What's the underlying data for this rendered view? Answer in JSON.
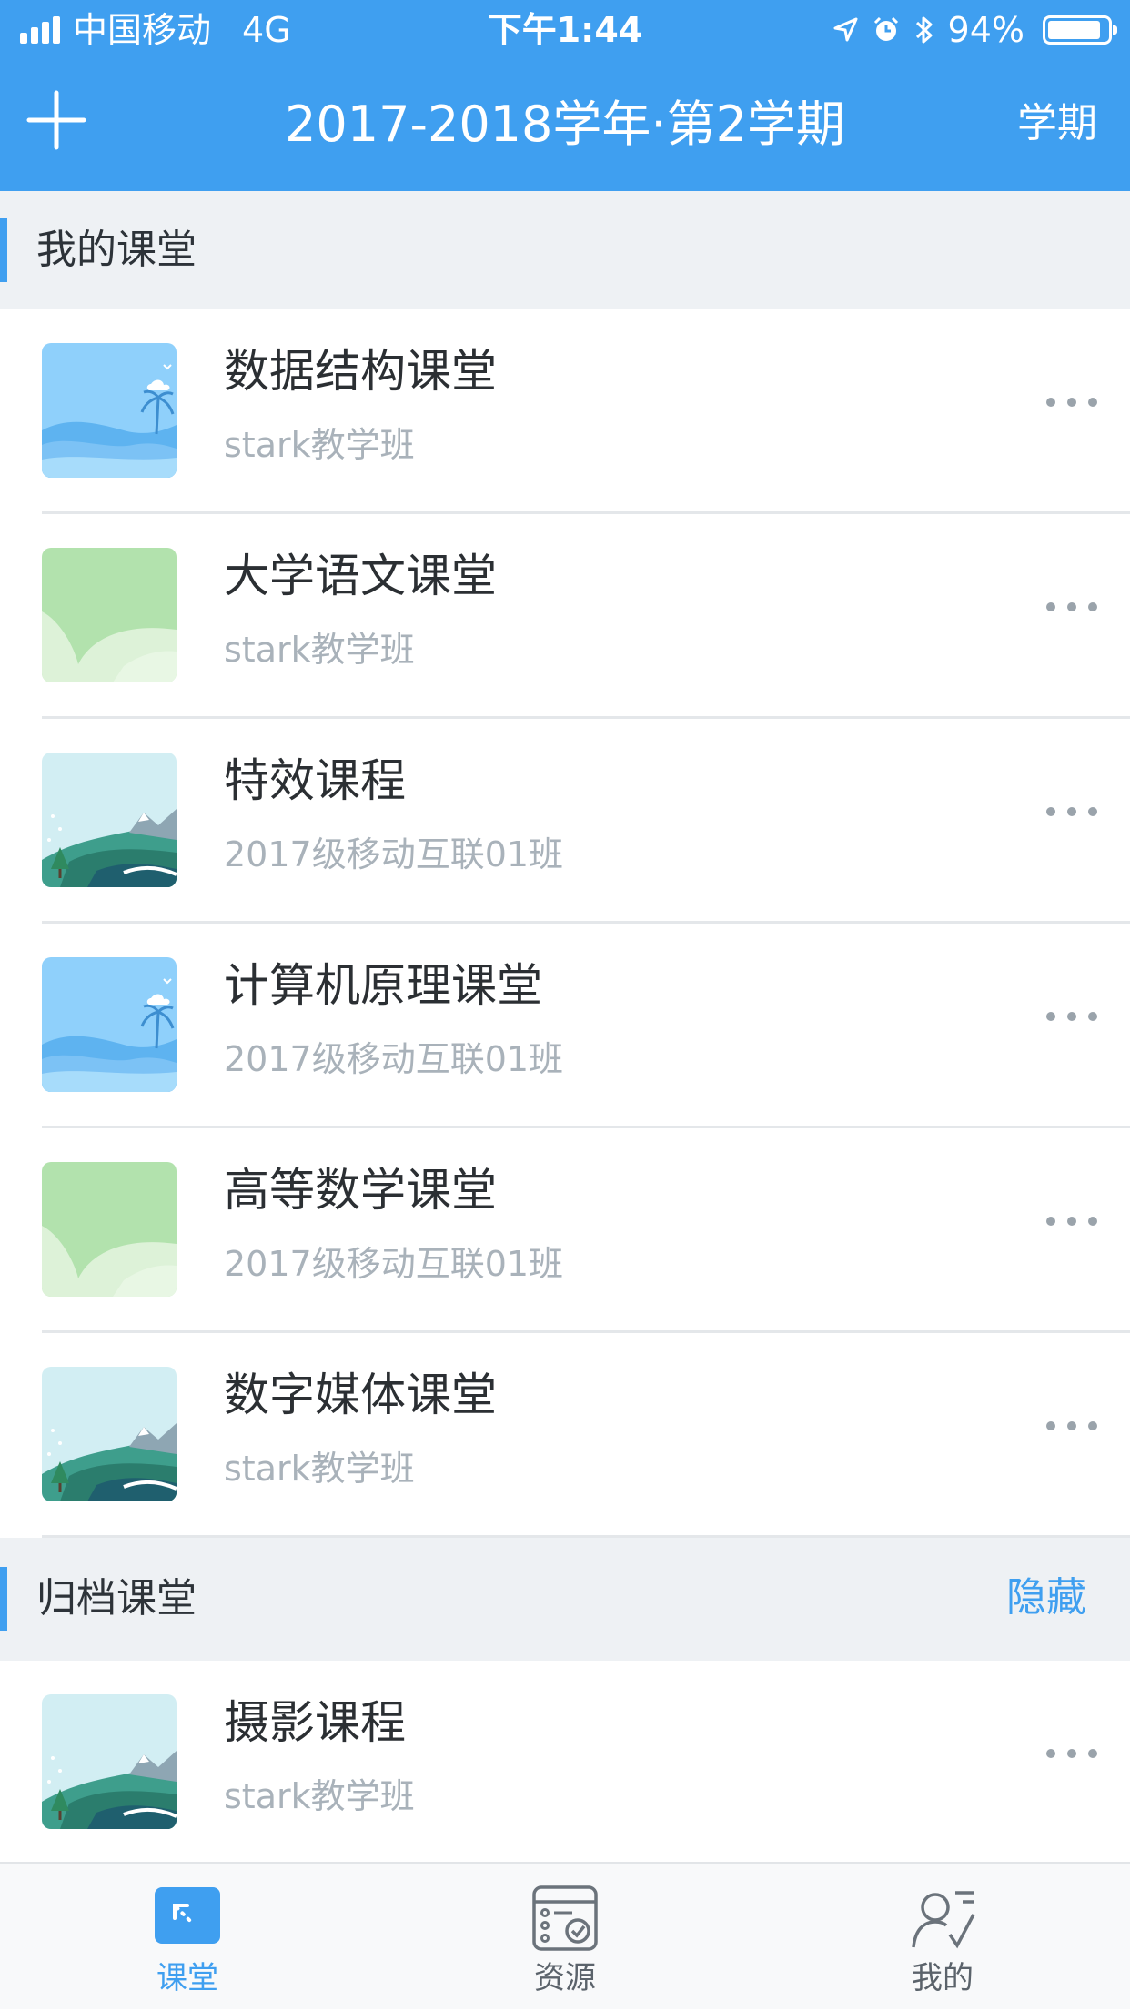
{
  "status_bar": {
    "carrier": "中国移动",
    "network": "4G",
    "time": "下午1:44",
    "battery": "94%",
    "battery_level": 0.94
  },
  "nav": {
    "title": "2017-2018学年·第2学期",
    "term_button": "学期",
    "add_icon": "plus-icon"
  },
  "my_classes": {
    "header": "我的课堂",
    "courses": [
      {
        "name": "数据结构课堂",
        "class": "stark教学班",
        "thumb": "beach"
      },
      {
        "name": "大学语文课堂",
        "class": "stark教学班",
        "thumb": "green"
      },
      {
        "name": "特效课程",
        "class": "2017级移动互联01班",
        "thumb": "hills"
      },
      {
        "name": "计算机原理课堂",
        "class": "2017级移动互联01班",
        "thumb": "beach"
      },
      {
        "name": "高等数学课堂",
        "class": "2017级移动互联01班",
        "thumb": "green"
      },
      {
        "name": "数字媒体课堂",
        "class": "stark教学班",
        "thumb": "hills"
      }
    ]
  },
  "archived": {
    "header": "归档课堂",
    "hide_button": "隐藏",
    "courses": [
      {
        "name": "摄影课程",
        "class": "stark教学班",
        "thumb": "hills"
      }
    ]
  },
  "tabs": [
    {
      "label": "课堂",
      "icon": "classroom-icon",
      "active": true
    },
    {
      "label": "资源",
      "icon": "resources-icon",
      "active": false
    },
    {
      "label": "我的",
      "icon": "profile-icon",
      "active": false
    }
  ],
  "colors": {
    "accent": "#3f9ff0",
    "section_bg": "#eef1f4",
    "muted_text": "#a9b2ba"
  }
}
